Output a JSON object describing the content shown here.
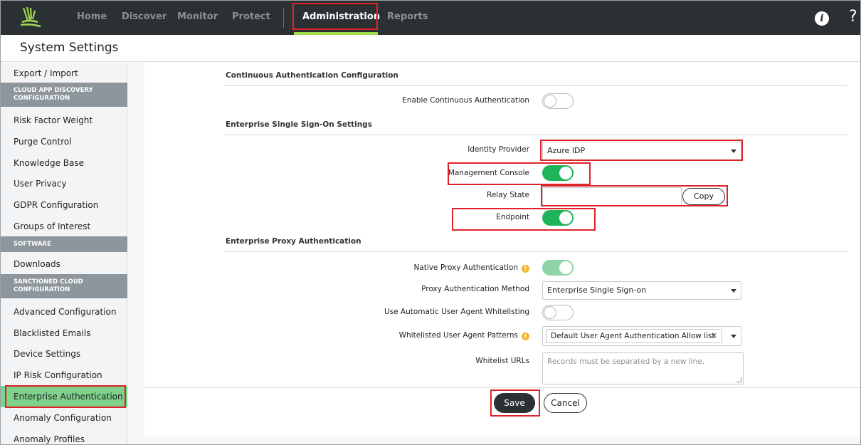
{
  "nav": {
    "items": [
      {
        "label": "Home"
      },
      {
        "label": "Discover"
      },
      {
        "label": "Monitor"
      },
      {
        "label": "Protect"
      },
      {
        "label": "Administration",
        "active": true
      },
      {
        "label": "Reports"
      }
    ],
    "info_icon": "i",
    "help_icon": "?"
  },
  "page_title": "System Settings",
  "sidebar": {
    "items": [
      {
        "label": "Export / Import",
        "type": "item"
      },
      {
        "label": "CLOUD APP DISCOVERY CONFIGURATION",
        "type": "section"
      },
      {
        "label": "Risk Factor Weight",
        "type": "item"
      },
      {
        "label": "Purge Control",
        "type": "item"
      },
      {
        "label": "Knowledge Base",
        "type": "item"
      },
      {
        "label": "User Privacy",
        "type": "item"
      },
      {
        "label": "GDPR Configuration",
        "type": "item"
      },
      {
        "label": "Groups of Interest",
        "type": "item"
      },
      {
        "label": "SOFTWARE",
        "type": "section"
      },
      {
        "label": "Downloads",
        "type": "item"
      },
      {
        "label": "SANCTIONED CLOUD CONFIGURATION",
        "type": "section"
      },
      {
        "label": "Advanced Configuration",
        "type": "item"
      },
      {
        "label": "Blacklisted Emails",
        "type": "item"
      },
      {
        "label": "Device Settings",
        "type": "item"
      },
      {
        "label": "IP Risk Configuration",
        "type": "item"
      },
      {
        "label": "Enterprise Authentication",
        "type": "item",
        "selected": true
      },
      {
        "label": "Anomaly Configuration",
        "type": "item"
      },
      {
        "label": "Anomaly Profiles",
        "type": "item"
      }
    ]
  },
  "main": {
    "continuous": {
      "heading": "Continuous Authentication Configuration",
      "enable_label": "Enable Continuous Authentication",
      "enable_value": false
    },
    "sso": {
      "heading": "Enterprise Single Sign-On Settings",
      "idp_label": "Identity Provider",
      "idp_value": "Azure IDP",
      "mgmt_label": "Management Console",
      "mgmt_value": true,
      "relay_label": "Relay State",
      "relay_value": "",
      "copy_label": "Copy",
      "endpoint_label": "Endpoint",
      "endpoint_value": true
    },
    "proxy": {
      "heading": "Enterprise Proxy Authentication",
      "native_label": "Native Proxy Authentication",
      "native_value": true,
      "method_label": "Proxy Authentication Method",
      "method_value": "Enterprise Single Sign-on",
      "auto_ua_label": "Use Automatic User Agent Whitelisting",
      "auto_ua_value": false,
      "patterns_label": "Whitelisted User Agent Patterns",
      "patterns_chip": "Default User Agent Authentication Allow list",
      "urls_label": "Whitelist URLs",
      "urls_placeholder": "Records must be separated by a new line."
    },
    "save_label": "Save",
    "cancel_label": "Cancel"
  },
  "colors": {
    "nav_bg": "#2b3033",
    "accent_green": "#1fb35a",
    "selected_green": "#7fd18b",
    "highlight_red": "#e0222a",
    "nav_underline": "#a3d94e"
  },
  "icons": {
    "logo": "brand-logo-icon",
    "info": "info-icon",
    "help": "help-icon",
    "info_dot": "info-dot-icon",
    "caret": "chevron-down-icon",
    "chip_remove": "close-icon"
  }
}
